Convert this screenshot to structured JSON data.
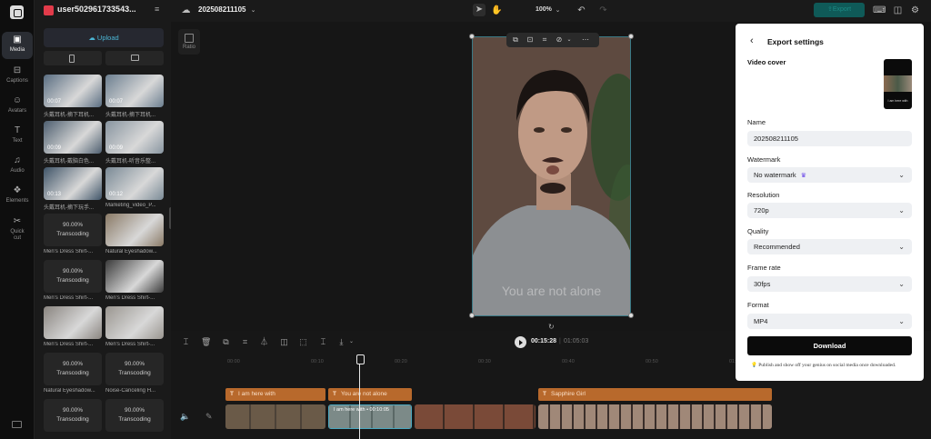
{
  "project": {
    "name": "user502961733543..."
  },
  "rail": {
    "items": [
      {
        "label": "Media",
        "icon": "media-icon",
        "active": true
      },
      {
        "label": "Captions",
        "icon": "captions-icon"
      },
      {
        "label": "Avatars",
        "icon": "avatars-icon"
      },
      {
        "label": "Text",
        "icon": "text-icon"
      },
      {
        "label": "Audio",
        "icon": "audio-icon"
      },
      {
        "label": "Elements",
        "icon": "elements-icon"
      },
      {
        "label": "Quick cut",
        "icon": "quick-cut-icon"
      }
    ]
  },
  "media": {
    "upload_label": "Upload",
    "items": [
      {
        "duration": "00:07",
        "caption": "头戴耳机-摘下耳机..."
      },
      {
        "duration": "00:07",
        "caption": "头戴耳机-摘下耳机..."
      },
      {
        "duration": "00:09",
        "caption": "头戴耳机-戴脑白色..."
      },
      {
        "duration": "00:09",
        "caption": "头戴耳机-听音乐整..."
      },
      {
        "duration": "00:13",
        "caption": "头戴耳机-摘下玩手..."
      },
      {
        "duration": "00:12",
        "caption": "Marketing_video_P..."
      },
      {
        "status": "90.00%",
        "sub": "Transcoding",
        "caption": "Men's Dress Shirt-..."
      },
      {
        "duration": "",
        "caption": "Natural Eyeshadow..."
      },
      {
        "status": "90.00%",
        "sub": "Transcoding",
        "caption": "Men's Dress Shirt-..."
      },
      {
        "duration": "",
        "caption": "Men's Dress Shirt-..."
      },
      {
        "duration": "",
        "caption": "Men's Dress Shirt-..."
      },
      {
        "duration": "",
        "caption": "Men's Dress Shirt-..."
      },
      {
        "status": "90.00%",
        "sub": "Transcoding",
        "caption": "Natural Eyeshadow..."
      },
      {
        "status": "90.00%",
        "sub": "Transcoding",
        "caption": "Noise-Canceling H..."
      },
      {
        "status": "90.00%",
        "sub": "Transcoding",
        "caption": ""
      },
      {
        "status": "90.00%",
        "sub": "Transcoding",
        "caption": ""
      }
    ]
  },
  "topbar": {
    "title": "202508211105",
    "zoom": "100%",
    "export_label": "Export"
  },
  "canvas": {
    "ratio_label": "Ratio",
    "subtitle": "You are not alone"
  },
  "timeline": {
    "current": "00:15:28",
    "total": "01:05:03",
    "ruler": [
      "00:00",
      "00:10",
      "00:20",
      "00:30",
      "00:40",
      "00:50",
      "01:00"
    ],
    "text_clips": [
      "I am here with",
      "You are not alone",
      "",
      "Sapphire Girl"
    ],
    "clip_label": "I am here with • 00:10:05"
  },
  "export": {
    "title": "Export settings",
    "cover_label": "Video cover",
    "cover_caption": "I am here with",
    "name_label": "Name",
    "name_value": "202508211105",
    "watermark_label": "Watermark",
    "watermark_value": "No watermark",
    "resolution_label": "Resolution",
    "resolution_value": "720p",
    "quality_label": "Quality",
    "quality_value": "Recommended",
    "framerate_label": "Frame rate",
    "framerate_value": "30fps",
    "format_label": "Format",
    "format_value": "MP4",
    "download_label": "Download",
    "note": "Publish and show off your genius on social media once downloaded."
  }
}
